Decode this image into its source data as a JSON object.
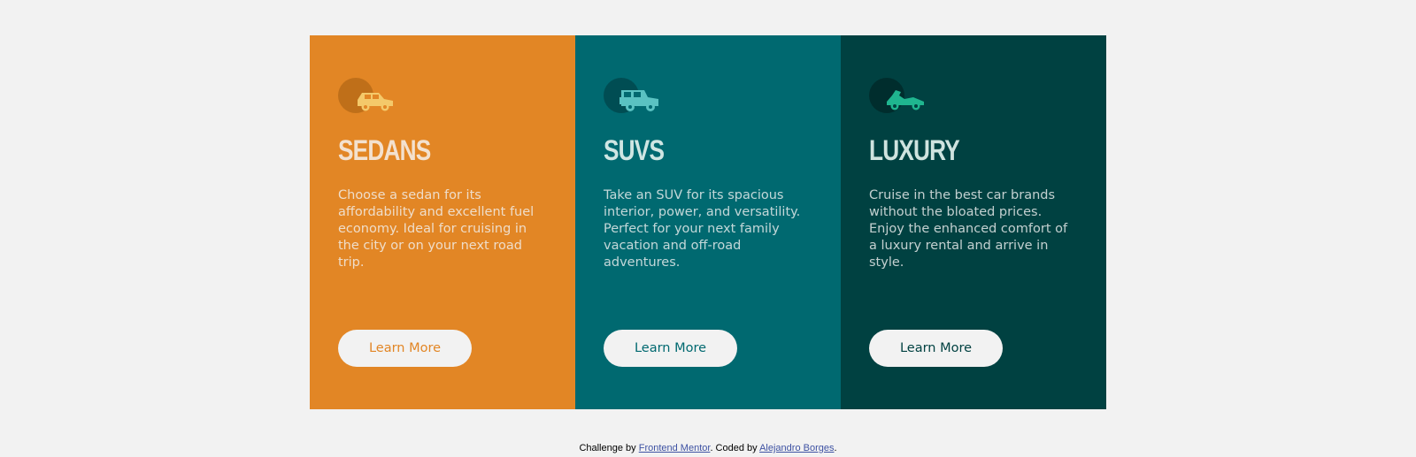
{
  "colors": {
    "background": "#f2f2f2",
    "sedans": "#e28625",
    "suvs": "#006970",
    "luxury": "#004141",
    "button_bg": "#f2f2f2",
    "link": "#3e52a3"
  },
  "cards": [
    {
      "icon": "sedan-car-icon",
      "title": "Sedans",
      "description": "Choose a sedan for its affordability and excellent fuel economy. Ideal for cruising in the city or on your next road trip.",
      "button_label": "Learn More"
    },
    {
      "icon": "suv-car-icon",
      "title": "SUVs",
      "description": "Take an SUV for its spacious interior, power, and versatility. Perfect for your next family vacation and off-road adventures.",
      "button_label": "Learn More"
    },
    {
      "icon": "luxury-car-icon",
      "title": "Luxury",
      "description": "Cruise in the best car brands without the bloated prices. Enjoy the enhanced comfort of a luxury rental and arrive in style.",
      "button_label": "Learn More"
    }
  ],
  "attribution": {
    "prefix": "Challenge by",
    "link1": "Frontend Mentor",
    "middle": ". Coded by",
    "link2": "Alejandro Borges",
    "suffix": "."
  }
}
